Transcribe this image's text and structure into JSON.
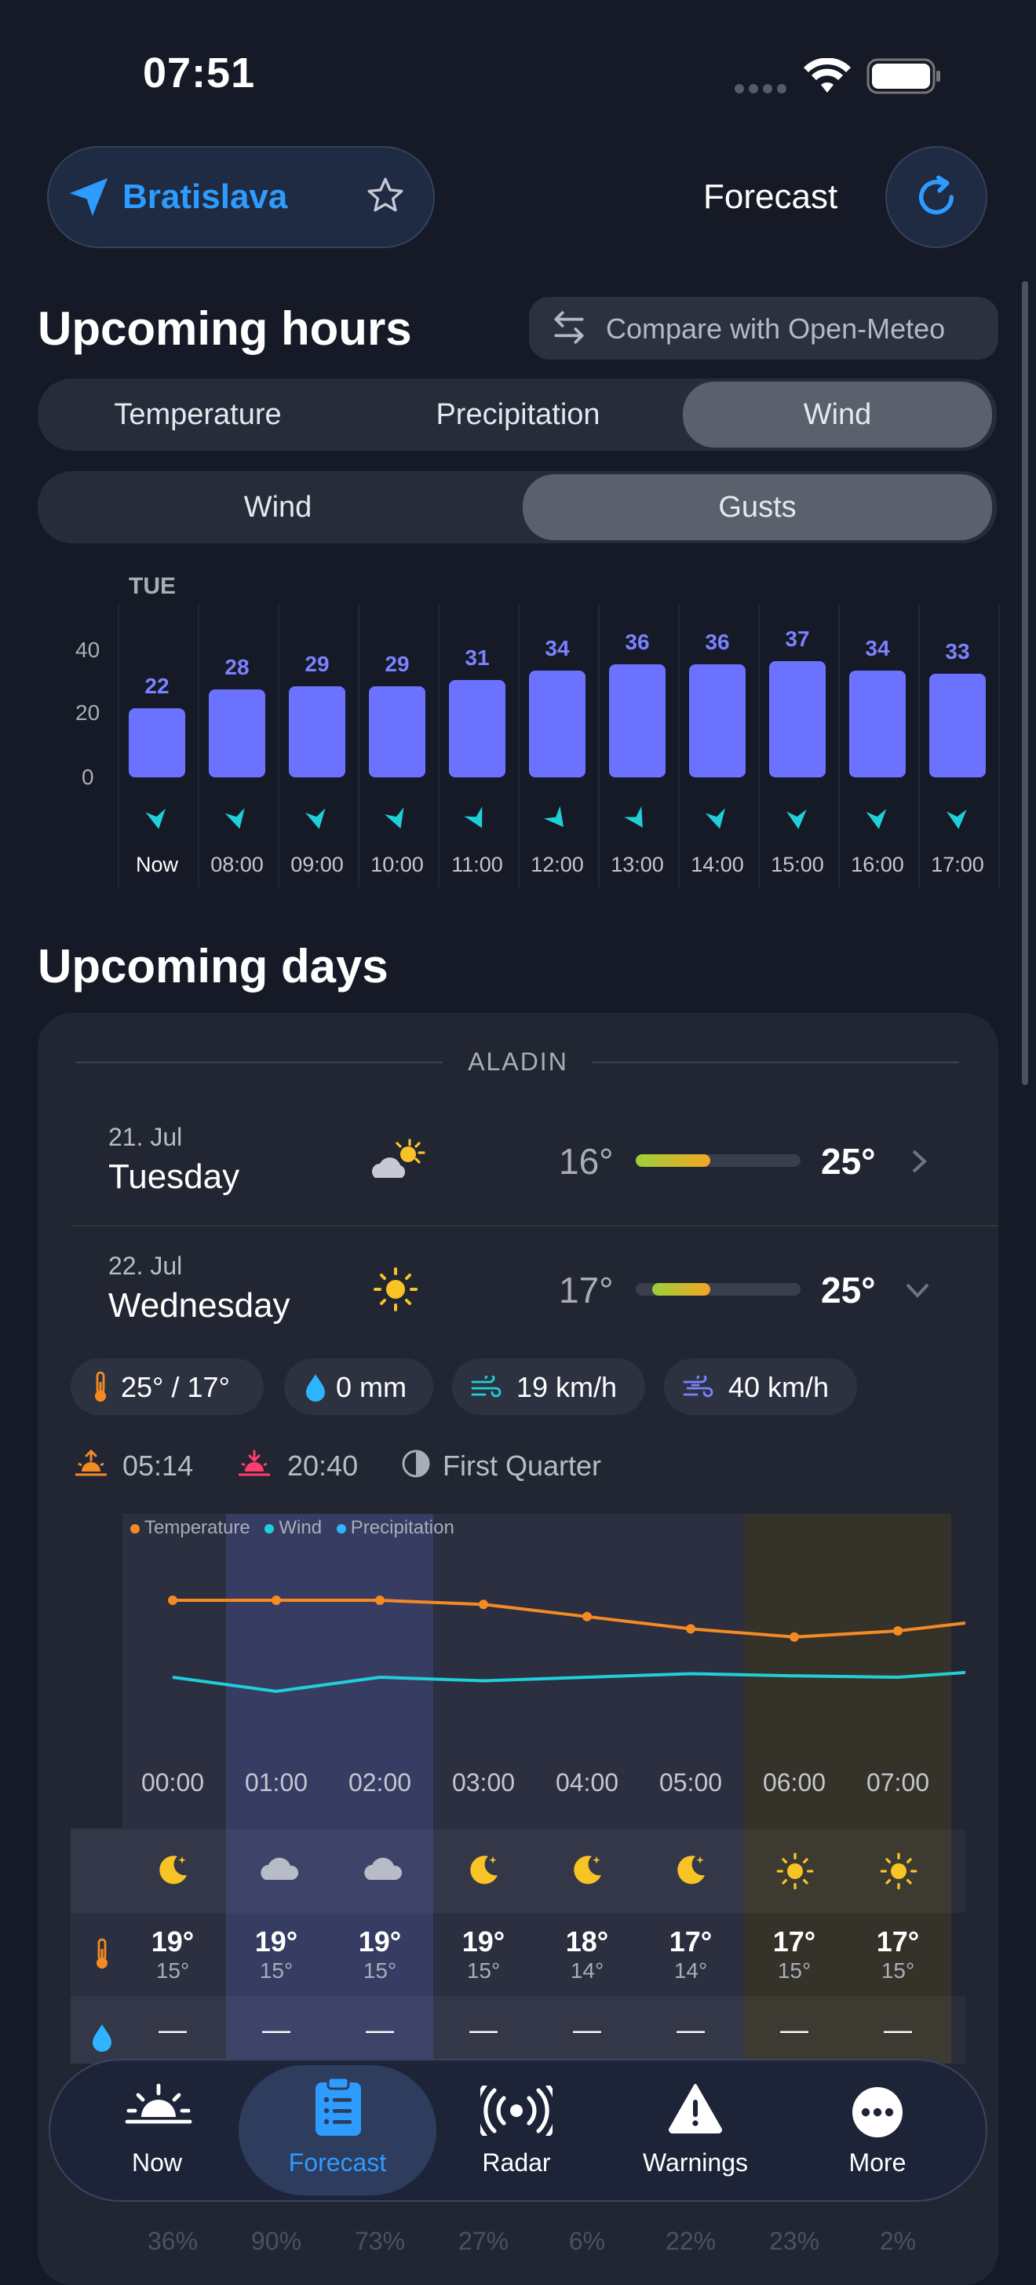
{
  "status_bar": {
    "time": "07:51"
  },
  "header": {
    "location": "Bratislava",
    "title": "Forecast"
  },
  "hours_section": {
    "title": "Upcoming hours",
    "compare_label": "Compare with Open-Meteo",
    "tabs": [
      "Temperature",
      "Precipitation",
      "Wind"
    ],
    "selected_tab": "Wind",
    "subtabs": [
      "Wind",
      "Gusts"
    ],
    "selected_subtab": "Gusts"
  },
  "chart_data": {
    "type": "bar",
    "day_label": "TUE",
    "categories": [
      "Now",
      "08:00",
      "09:00",
      "10:00",
      "11:00",
      "12:00",
      "13:00",
      "14:00",
      "15:00",
      "16:00",
      "17:00"
    ],
    "values": [
      22,
      28,
      29,
      29,
      31,
      34,
      36,
      36,
      37,
      34,
      33
    ],
    "y_ticks": [
      "40",
      "20",
      "0"
    ],
    "ylim": [
      0,
      40
    ],
    "colors": {
      "bar": "#6a72ff",
      "arrow": "#1fd0d8"
    }
  },
  "days_section": {
    "title": "Upcoming days",
    "model_label": "ALADIN",
    "days": [
      {
        "date": "21. Jul",
        "name": "Tuesday",
        "icon": "partly-cloudy-icon",
        "low": "16°",
        "high": "25°",
        "range": [
          0.0,
          0.45
        ]
      },
      {
        "date": "22. Jul",
        "name": "Wednesday",
        "icon": "sun-icon",
        "low": "17°",
        "high": "25°",
        "range": [
          0.1,
          0.45
        ]
      }
    ],
    "details": {
      "chips": [
        {
          "icon": "thermometer-icon",
          "text": "25° / 17°"
        },
        {
          "icon": "drop-icon",
          "text": "0 mm"
        },
        {
          "icon": "wind-icon",
          "text": "19 km/h"
        },
        {
          "icon": "gusts-icon",
          "text": "40 km/h"
        }
      ],
      "sunrise": "05:14",
      "sunset": "20:40",
      "moon": "First Quarter",
      "legend": [
        "Temperature",
        "Wind",
        "Precipitation"
      ],
      "hours": [
        {
          "time": "00:00",
          "icon": "moon-icon",
          "hi": "19°",
          "lo": "15°",
          "temp": 19.0,
          "wind": 12
        },
        {
          "time": "01:00",
          "icon": "cloud-icon",
          "hi": "19°",
          "lo": "15°",
          "temp": 19.0,
          "wind": 10
        },
        {
          "time": "02:00",
          "icon": "cloud-icon",
          "hi": "19°",
          "lo": "15°",
          "temp": 19.0,
          "wind": 12
        },
        {
          "time": "03:00",
          "icon": "moon-icon",
          "hi": "19°",
          "lo": "15°",
          "temp": 18.8,
          "wind": 11.5
        },
        {
          "time": "04:00",
          "icon": "moon-icon",
          "hi": "18°",
          "lo": "14°",
          "temp": 18.2,
          "wind": 12
        },
        {
          "time": "05:00",
          "icon": "moon-icon",
          "hi": "17°",
          "lo": "14°",
          "temp": 17.6,
          "wind": 12.5
        },
        {
          "time": "06:00",
          "icon": "sun-icon",
          "hi": "17°",
          "lo": "15°",
          "temp": 17.2,
          "wind": 12.2
        },
        {
          "time": "07:00",
          "icon": "sun-icon",
          "hi": "17°",
          "lo": "15°",
          "temp": 17.5,
          "wind": 12
        }
      ],
      "precip_dash": "—",
      "bottom_row": [
        "36%",
        "90%",
        "73%",
        "27%",
        "6%",
        "22%",
        "23%",
        "2%"
      ]
    }
  },
  "tab_bar": {
    "items": [
      {
        "label": "Now",
        "icon": "sunrise-icon"
      },
      {
        "label": "Forecast",
        "icon": "clipboard-icon"
      },
      {
        "label": "Radar",
        "icon": "radar-icon"
      },
      {
        "label": "Warnings",
        "icon": "warning-icon"
      },
      {
        "label": "More",
        "icon": "more-icon"
      }
    ],
    "active": "Forecast",
    "active_color": "#2e9bff"
  }
}
